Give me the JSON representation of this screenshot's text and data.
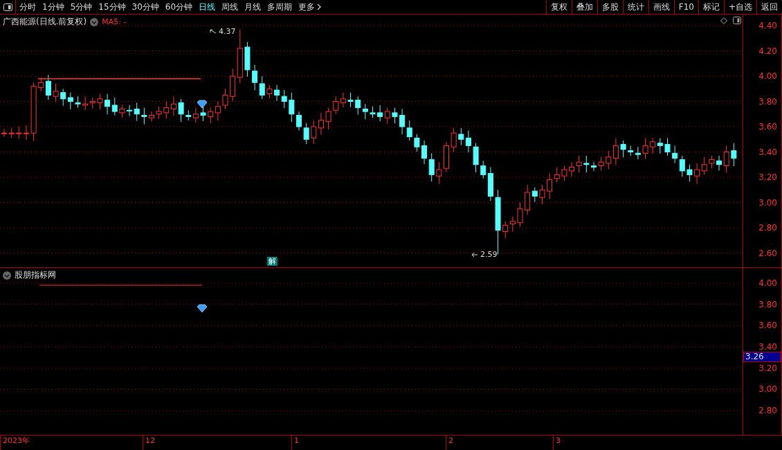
{
  "toolbar": {
    "periods": [
      {
        "label": "分时",
        "selected": false
      },
      {
        "label": "1分钟",
        "selected": false
      },
      {
        "label": "5分钟",
        "selected": false
      },
      {
        "label": "15分钟",
        "selected": false
      },
      {
        "label": "30分钟",
        "selected": false
      },
      {
        "label": "60分钟",
        "selected": false
      },
      {
        "label": "日线",
        "selected": true
      },
      {
        "label": "周线",
        "selected": false
      },
      {
        "label": "月线",
        "selected": false
      },
      {
        "label": "多周期",
        "selected": false
      },
      {
        "label": "更多",
        "selected": false
      }
    ],
    "buttons": [
      "复权",
      "叠加",
      "多股",
      "统计",
      "画线",
      "F10",
      "标记",
      "+自选",
      "返回"
    ]
  },
  "main_chart": {
    "title": "广西能源(日线.前复权)",
    "indicator": "MA5: -",
    "high_label": "4.37",
    "low_label": "2.59",
    "badge": "解",
    "y_axis": [
      "4.40",
      "4.20",
      "4.00",
      "3.80",
      "3.60",
      "3.40",
      "3.20",
      "3.00",
      "2.80",
      "2.60"
    ]
  },
  "indicator_panel": {
    "title": "股朋指标网",
    "y_axis": [
      "4.00",
      "3.80",
      "3.60",
      "3.40",
      "3.20",
      "3.00",
      "2.80"
    ],
    "current_value": "3.26"
  },
  "date_axis": [
    "2023年",
    "12",
    "1",
    "2",
    "3"
  ]
}
